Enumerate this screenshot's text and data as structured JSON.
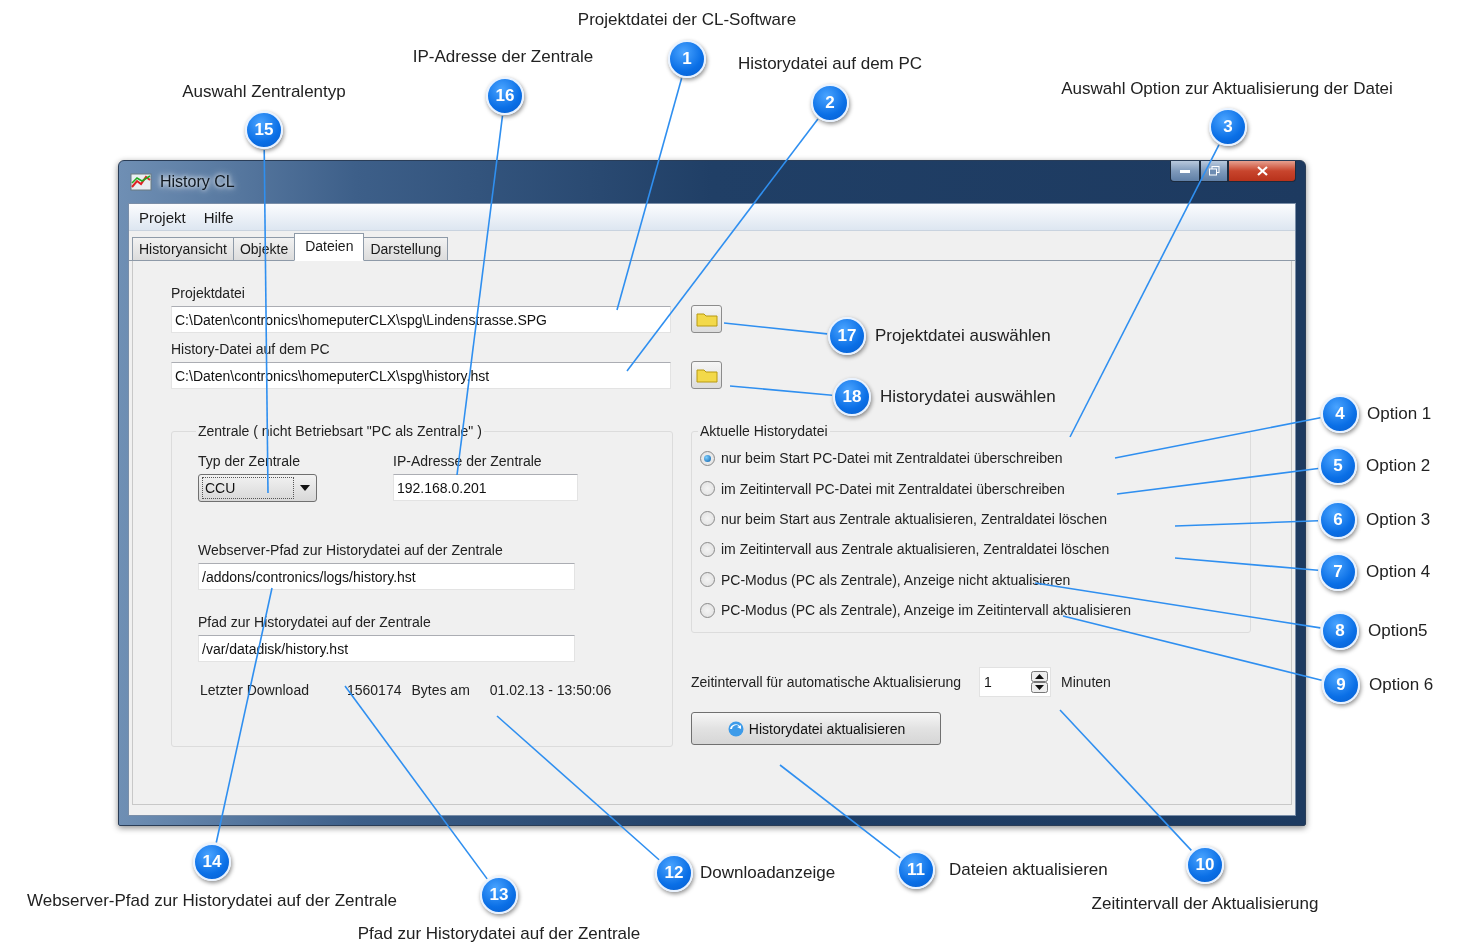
{
  "window": {
    "title": "History CL"
  },
  "menu": [
    "Projekt",
    "Hilfe"
  ],
  "tabs": [
    {
      "label": "Historyansicht",
      "selected": false
    },
    {
      "label": "Objekte",
      "selected": false
    },
    {
      "label": "Dateien",
      "selected": true
    },
    {
      "label": "Darstellung",
      "selected": false
    }
  ],
  "files": [
    {
      "label": "Projektdatei",
      "value": "C:\\Daten\\contronics\\homeputerCLX\\spg\\Lindenstrasse.SPG"
    },
    {
      "label": "History-Datei auf dem PC",
      "value": "C:\\Daten\\contronics\\homeputerCLX\\spg\\history.hst"
    }
  ],
  "central": {
    "legend": "Zentrale ( nicht Betriebsart \"PC als Zentrale\" )",
    "type_label": "Typ der Zentrale",
    "type_value": "CCU",
    "ip_label": "IP-Adresse der Zentrale",
    "ip_value": "192.168.0.201",
    "webserver_label": "Webserver-Pfad zur Historydatei auf der Zentrale",
    "webserver_value": "/addons/contronics/logs/history.hst",
    "path_label": "Pfad zur Historydatei auf der Zentrale",
    "path_value": "/var/datadisk/history.hst",
    "download": {
      "label": "Letzter Download",
      "bytes": "1560174",
      "bytes_unit": "Bytes am",
      "timestamp": "01.02.13 - 13:50:06"
    }
  },
  "history": {
    "legend": "Aktuelle Historydatei",
    "options": [
      {
        "label": "nur beim Start PC-Datei mit Zentraldatei überschreiben",
        "selected": true
      },
      {
        "label": "im Zeitintervall PC-Datei mit Zentraldatei überschreiben",
        "selected": false
      },
      {
        "label": "nur beim Start aus Zentrale aktualisieren, Zentraldatei löschen",
        "selected": false
      },
      {
        "label": "im Zeitintervall aus Zentrale aktualisieren, Zentraldatei löschen",
        "selected": false
      },
      {
        "label": "PC-Modus (PC als Zentrale), Anzeige nicht aktualisieren",
        "selected": false
      },
      {
        "label": "PC-Modus (PC als Zentrale), Anzeige im Zeitintervall aktualisieren",
        "selected": false
      }
    ]
  },
  "interval": {
    "label": "Zeitintervall für automatische Aktualisierung",
    "value": "1",
    "unit": "Minuten"
  },
  "update_button": "Historydatei aktualisieren",
  "callouts": [
    {
      "number": "1",
      "label": "Projektdatei der CL-Software"
    },
    {
      "number": "16",
      "label": "IP-Adresse der Zentrale"
    },
    {
      "number": "2",
      "label": "Historydatei auf dem PC"
    },
    {
      "number": "15",
      "label": "Auswahl Zentralentyp"
    },
    {
      "number": "3",
      "label": "Auswahl Option zur Aktualisierung der Datei"
    },
    {
      "number": "17",
      "label": "Projektdatei auswählen"
    },
    {
      "number": "18",
      "label": "Historydatei auswählen"
    },
    {
      "number": "4",
      "label": "Option 1"
    },
    {
      "number": "5",
      "label": "Option 2"
    },
    {
      "number": "6",
      "label": "Option 3"
    },
    {
      "number": "7",
      "label": "Option 4"
    },
    {
      "number": "8",
      "label": "Option5"
    },
    {
      "number": "9",
      "label": "Option 6"
    },
    {
      "number": "14",
      "label": "Webserver-Pfad zur Historydatei auf der Zentrale"
    },
    {
      "number": "12",
      "label": "Downloadanzeige"
    },
    {
      "number": "11",
      "label": "Dateien aktualisieren"
    },
    {
      "number": "10",
      "label": "Zeitintervall der Aktualisierung"
    },
    {
      "number": "13",
      "label": "Pfad zur Historydatei auf der Zentrale"
    }
  ]
}
